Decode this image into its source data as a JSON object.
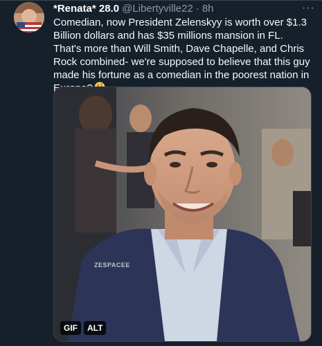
{
  "tweet": {
    "display_name": "*Renata* 28.0",
    "handle": "@Libertyville22",
    "separator": "·",
    "time": "8h",
    "more_label": "···",
    "text": "Comedian, now President Zelenskyy is worth over $1.3 Billion dollars and has $35 millions mansion in FL. That's more than Will Smith, Dave Chapelle, and Chris Rock combined- we're supposed to believe that this guy made his fortune as a comedian in the poorest nation in Europe?",
    "emoji": "thinking-face-emoji",
    "media": {
      "watermark": "ZESPACEE",
      "gif_label": "GIF",
      "alt_label": "ALT"
    }
  },
  "colors": {
    "background": "#15202b",
    "text": "#f7f9f9",
    "secondary_text": "#8b98a5",
    "border": "#38444d"
  }
}
